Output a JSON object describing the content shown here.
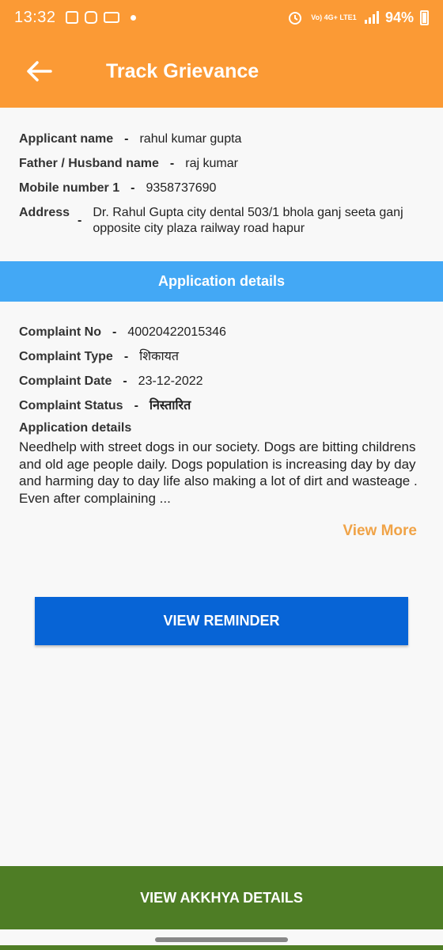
{
  "status_bar": {
    "time": "13:32",
    "network": "Vo) 4G+ LTE1",
    "battery": "94%",
    "icons": [
      "gallery-icon",
      "instagram-icon",
      "voicemail-icon",
      "alarm-icon",
      "signal-icon",
      "battery-icon"
    ]
  },
  "app_bar": {
    "title": "Track Grievance",
    "back_icon": "arrow-left-icon"
  },
  "applicant": {
    "name_label": "Applicant name",
    "name_value": "rahul kumar gupta",
    "father_label": "Father / Husband name",
    "father_value": "raj kumar",
    "mobile_label": "Mobile number 1",
    "mobile_value": "9358737690",
    "address_label": "Address",
    "address_value": "Dr. Rahul Gupta city dental 503/1 bhola ganj seeta ganj opposite city plaza railway road hapur"
  },
  "section_title": "Application details",
  "complaint": {
    "no_label": "Complaint No",
    "no_value": "40020422015346",
    "type_label": "Complaint Type",
    "type_value": "शिकायत",
    "date_label": "Complaint Date",
    "date_value": "23-12-2022",
    "status_label": "Complaint Status",
    "status_value": "निस्तारित",
    "details_label": "Application details",
    "details_text": "Needhelp with street dogs in our society. Dogs are bitting childrens and old age people daily. Dogs population is increasing day by day and harming day to day life also making a lot of dirt and wasteage . Even after complaining ..."
  },
  "view_more_label": "View More",
  "buttons": {
    "reminder": "VIEW REMINDER",
    "akkhya": "VIEW AKKHYA DETAILS"
  },
  "colors": {
    "header": "#fb9a35",
    "band": "#43a8f5",
    "reminder_button": "#0764d6",
    "akkhya_button": "#4e7d25",
    "status_text": "#2e8b2e",
    "view_more": "#f0a347"
  }
}
